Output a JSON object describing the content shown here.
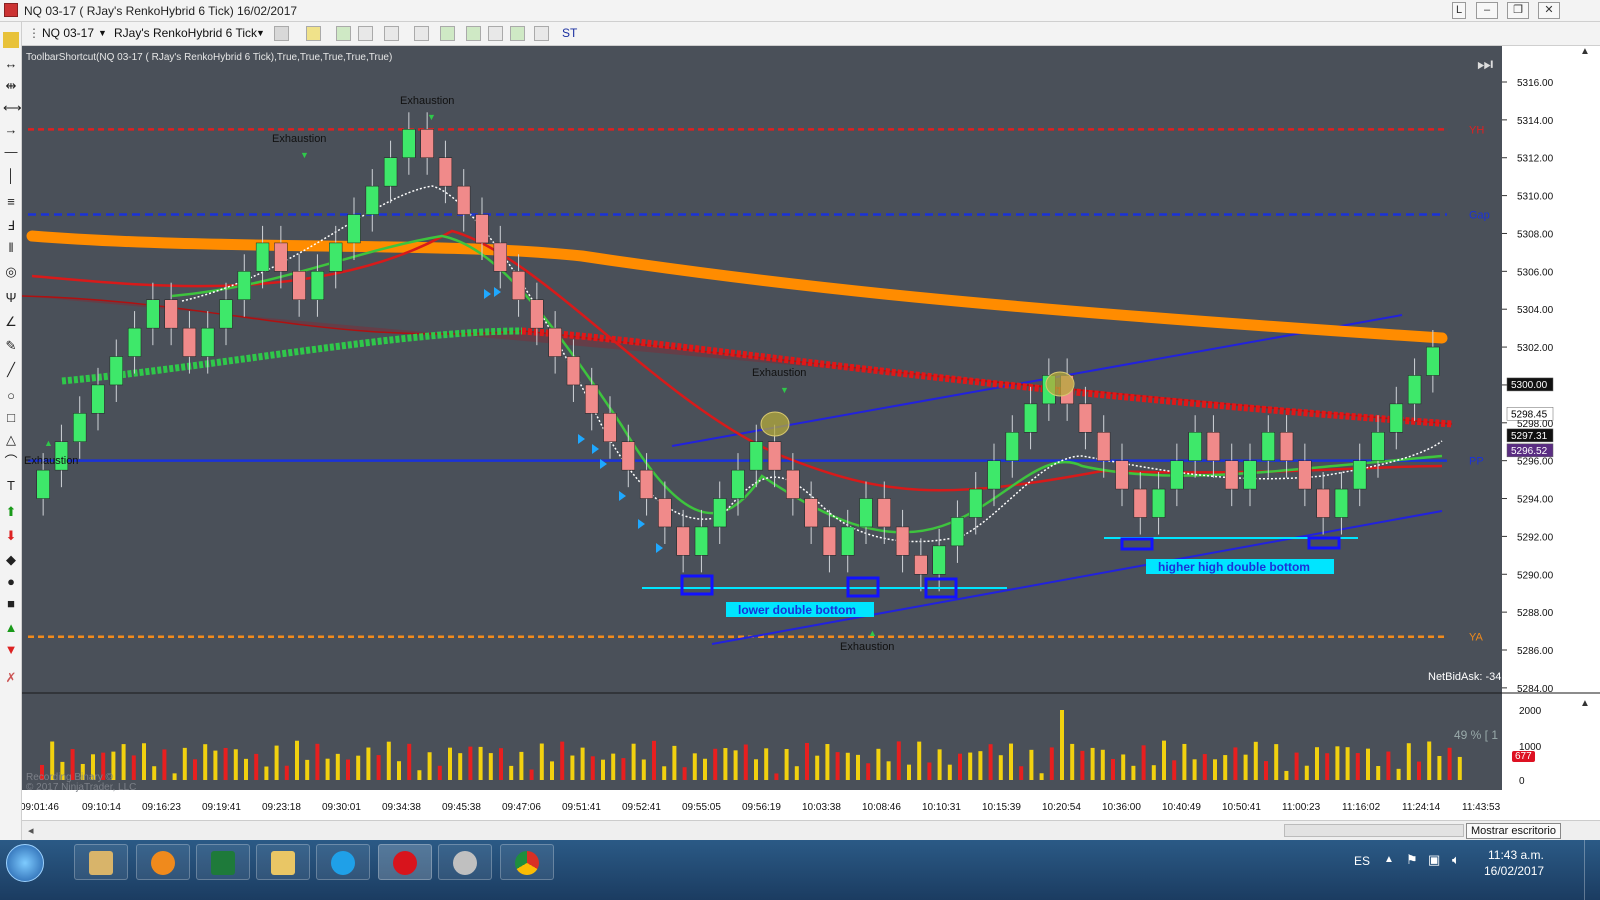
{
  "window": {
    "title": "NQ 03-17 ( RJay's RenkoHybrid  6 Tick)  16/02/2017"
  },
  "toolbar": {
    "instrument": "NQ 03-17",
    "chart_type": "RJay's RenkoHybrid  6 Tick",
    "st_label": "ST"
  },
  "chart": {
    "indicator_label": "ToolbarShortcut(NQ 03-17 ( RJay's RenkoHybrid  6 Tick),True,True,True,True,True)",
    "watermark_recording": "Recording Binary ©",
    "watermark_copyright": "© 2017 NinjaTrader, LLC",
    "netbidask": "NetBidAsk: -34",
    "volume_pct": "49 % [ 1",
    "volume_badge": "677"
  },
  "price_axis": {
    "ticks": [
      "5316.00",
      "5314.00",
      "5312.00",
      "5310.00",
      "5308.00",
      "5306.00",
      "5304.00",
      "5302.00",
      "5300.00",
      "5298.00",
      "5296.00",
      "5294.00",
      "5292.00",
      "5290.00",
      "5288.00",
      "5286.00",
      "5284.00"
    ],
    "badges": [
      {
        "label": "5300.00",
        "value": 5300.0,
        "bg": "#111111",
        "fg": "#ffffff"
      },
      {
        "label": "5298.45",
        "value": 5298.45,
        "bg": "#ffffff",
        "fg": "#000000"
      },
      {
        "label": "5297.31",
        "value": 5297.31,
        "bg": "#111111",
        "fg": "#ffffff"
      },
      {
        "label": "5296.52",
        "value": 5296.52,
        "bg": "#5a2d82",
        "fg": "#ffffff"
      }
    ]
  },
  "volume_axis": {
    "ticks": [
      "2000",
      "1000",
      "0"
    ]
  },
  "time_axis": {
    "ticks": [
      "09:01:46",
      "09:10:14",
      "09:16:23",
      "09:19:41",
      "09:23:18",
      "09:30:01",
      "09:34:38",
      "09:45:38",
      "09:47:06",
      "09:51:41",
      "09:52:41",
      "09:55:05",
      "09:56:19",
      "10:03:38",
      "10:08:46",
      "10:10:31",
      "10:15:39",
      "10:20:54",
      "10:36:00",
      "10:40:49",
      "10:50:41",
      "11:00:23",
      "11:16:02",
      "11:24:14",
      "11:43:53"
    ]
  },
  "levels": [
    {
      "name": "YH",
      "price": 5313.5,
      "color": "#e02020"
    },
    {
      "name": "Gap",
      "price": 5309.0,
      "color": "#1a32d8"
    },
    {
      "name": "PP",
      "price": 5296.0,
      "color": "#1a32d8"
    },
    {
      "name": "YA",
      "price": 5286.7,
      "color": "#f08a1c"
    }
  ],
  "annotations": {
    "exhaustion": [
      "Exhaustion",
      "Exhaustion",
      "Exhaustion",
      "Exhaustion",
      "Exhaustion"
    ],
    "lower_double_bottom": "lower double bottom",
    "higher_high_double_bottom": "higher high double bottom"
  },
  "colors": {
    "bg": "#4a5059",
    "up": "#3ee86a",
    "down": "#f08a8a",
    "axis_bg": "#ffffff",
    "sma_orange": "#ff8c00",
    "ema_red": "#e01818"
  },
  "bottombar": {
    "tooltip": "Mostrar escritorio"
  },
  "taskbar": {
    "lang": "ES",
    "time": "11:43 a.m.",
    "date": "16/02/2017"
  },
  "chart_data": {
    "type": "candlestick",
    "ylim": [
      5284,
      5317
    ],
    "closes": [
      5295.5,
      5297.0,
      5298.5,
      5300.0,
      5301.5,
      5303.0,
      5304.5,
      5303.0,
      5301.5,
      5303.0,
      5304.5,
      5306.0,
      5307.5,
      5306.0,
      5304.5,
      5306.0,
      5307.5,
      5309.0,
      5310.5,
      5312.0,
      5313.5,
      5312.0,
      5310.5,
      5309.0,
      5307.5,
      5306.0,
      5304.5,
      5303.0,
      5301.5,
      5300.0,
      5298.5,
      5297.0,
      5295.5,
      5294.0,
      5292.5,
      5291.0,
      5292.5,
      5294.0,
      5295.5,
      5297.0,
      5295.5,
      5294.0,
      5292.5,
      5291.0,
      5292.5,
      5294.0,
      5292.5,
      5291.0,
      5290.0,
      5291.5,
      5293.0,
      5294.5,
      5296.0,
      5297.5,
      5299.0,
      5300.5,
      5299.0,
      5297.5,
      5296.0,
      5294.5,
      5293.0,
      5294.5,
      5296.0,
      5297.5,
      5296.0,
      5294.5,
      5296.0,
      5297.5,
      5296.0,
      5294.5,
      5293.0,
      5294.5,
      5296.0,
      5297.5,
      5299.0,
      5300.5,
      5302.0
    ]
  }
}
